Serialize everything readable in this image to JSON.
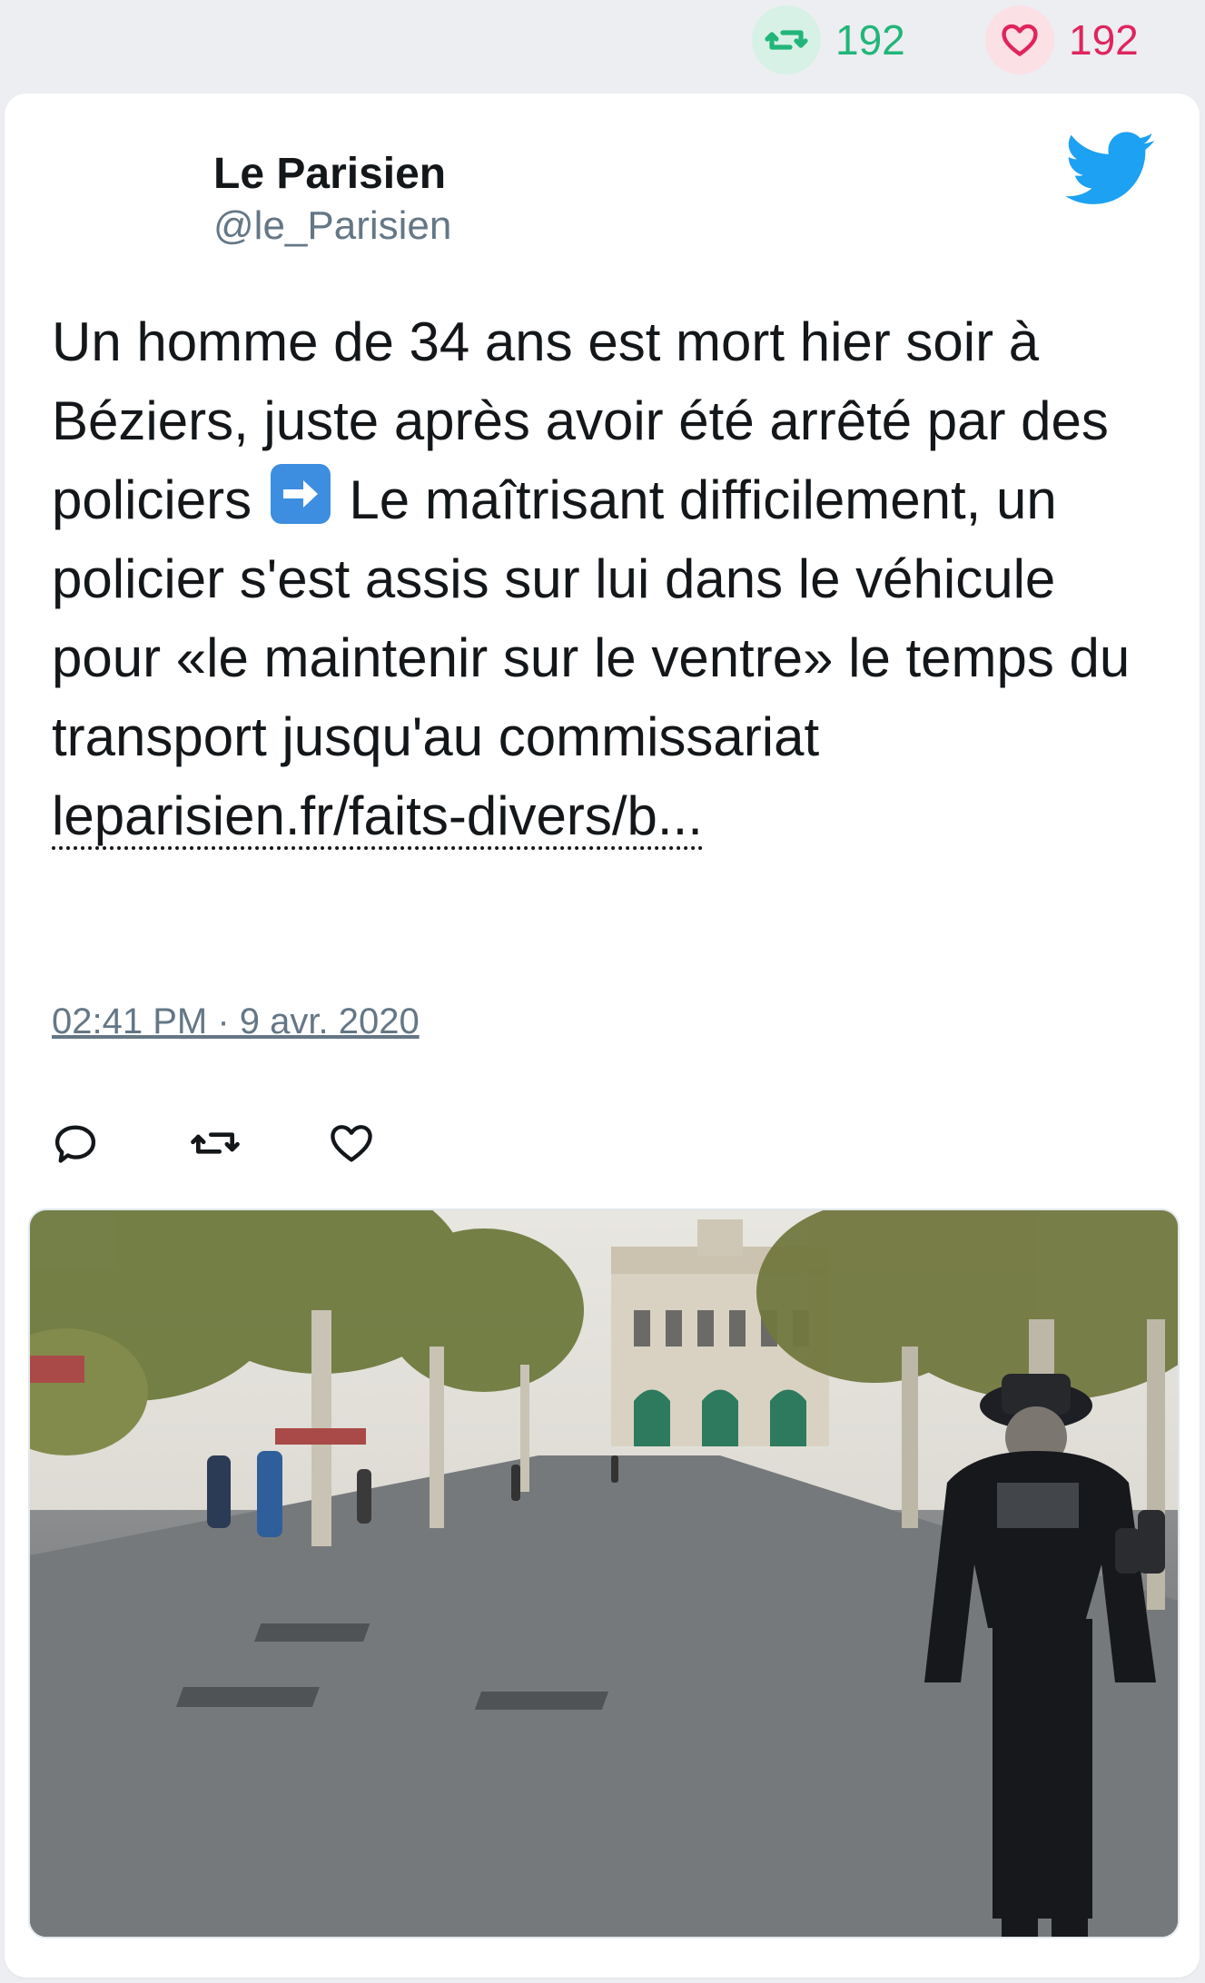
{
  "stats": {
    "retweet_count": "192",
    "like_count": "192"
  },
  "author": {
    "name": "Le Parisien",
    "handle": "@le_Parisien"
  },
  "tweet": {
    "text_part1": "Un homme de 34 ans est mort hier soir à Béziers, juste après avoir été arrêté par des policiers ",
    "emoji": "right-arrow-emoji",
    "text_part2": " Le maîtrisant difficilement, un policier s'est assis sur lui dans le véhicule pour «le maintenir sur le ventre» le temps du transport jusqu'au commissariat ",
    "link_text": "leparisien.fr/faits-divers/b...",
    "timestamp": "02:41 PM · 9 avr. 2020"
  },
  "icons": {
    "retweet": "retweet-icon",
    "like": "heart-icon",
    "reply": "reply-icon",
    "brand": "twitter-bird-icon"
  },
  "colors": {
    "retweet_green": "#22b57a",
    "like_red": "#e0245e",
    "twitter_blue": "#1da1f2",
    "text": "#14171a",
    "muted": "#657786"
  }
}
